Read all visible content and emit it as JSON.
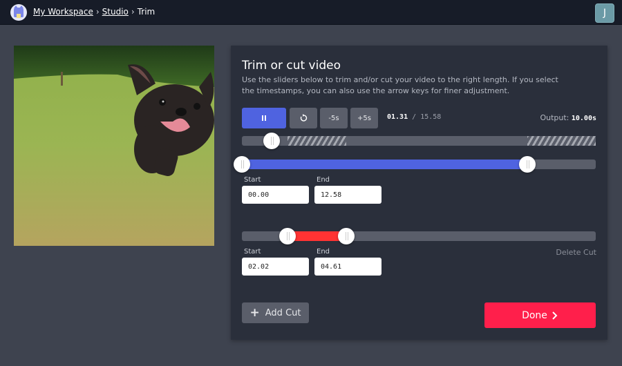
{
  "header": {
    "breadcrumbs": [
      "My Workspace",
      "Studio",
      "Trim"
    ],
    "separator": "›",
    "user_initial": "J"
  },
  "preview": {
    "description": "French bulldog puppy running on grass"
  },
  "editor": {
    "title": "Trim or cut video",
    "description": "Use the sliders below to trim and/or cut your video to the right length. If you select the timestamps, you can also use the arrow keys for finer adjustment.",
    "controls": {
      "play_state": "playing",
      "restart_icon": "restart-icon",
      "minus_label": "-5s",
      "plus_label": "+5s"
    },
    "current_time": "01.31",
    "time_separator": "/",
    "total_time": "15.58",
    "output_label": "Output:",
    "output_value": "10.00s",
    "timeline": {
      "duration": 15.58,
      "playhead": 1.31
    },
    "trim": {
      "start_label": "Start",
      "end_label": "End",
      "start": "00.00",
      "end": "12.58",
      "start_value": 0.0,
      "end_value": 12.58,
      "color": "#4f63e0"
    },
    "cuts": [
      {
        "start_label": "Start",
        "end_label": "End",
        "start": "02.02",
        "end": "04.61",
        "start_value": 2.02,
        "end_value": 4.61,
        "color": "#ff3333",
        "delete_label": "Delete Cut"
      }
    ],
    "add_cut_label": "Add Cut",
    "done_label": "Done"
  }
}
